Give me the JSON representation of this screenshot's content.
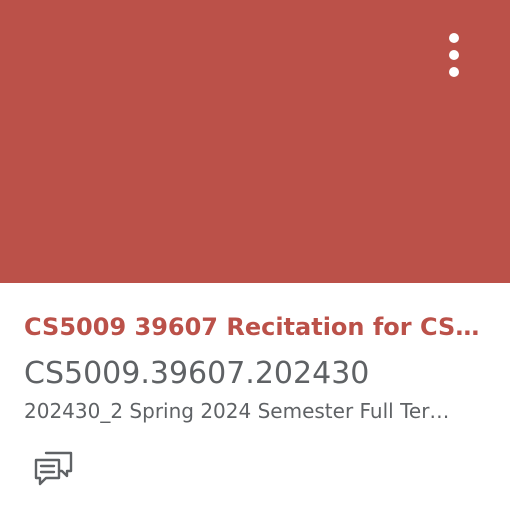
{
  "course_card": {
    "title": "CS5009 39607 Recitation for CS 5…",
    "code": "CS5009.39607.202430",
    "term": "202430_2 Spring 2024 Semester Full Ter…",
    "hero_color": "#bb5149",
    "menu_icon": "kebab-menu-icon",
    "actions": [
      {
        "icon": "discussions-icon"
      }
    ]
  }
}
